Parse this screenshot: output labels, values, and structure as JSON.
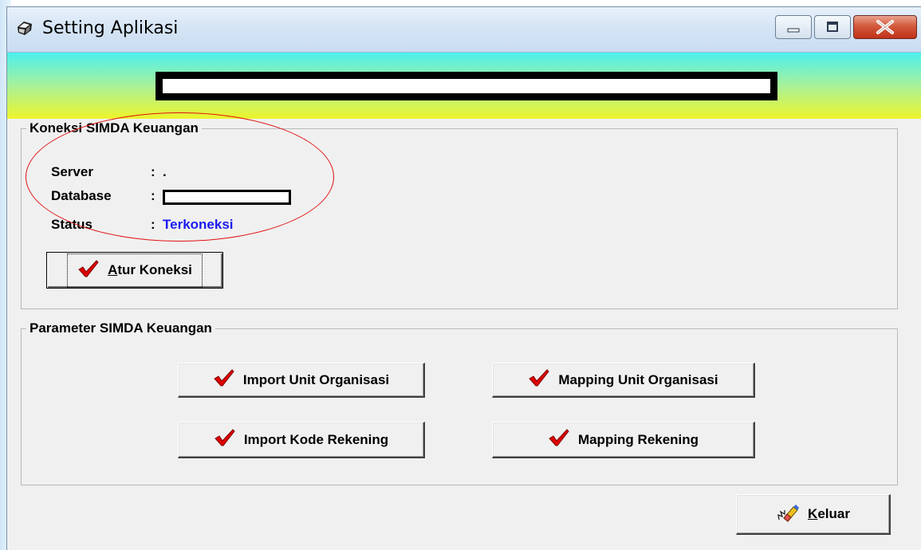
{
  "window": {
    "title": "Setting Aplikasi"
  },
  "titlebar_buttons": {
    "minimize": "minimize-icon",
    "maximize": "maximize-icon",
    "close": "close-icon"
  },
  "koneksi": {
    "legend": "Koneksi SIMDA Keuangan",
    "server_label": "Server",
    "server_value": ".",
    "database_label": "Database",
    "status_label": "Status",
    "status_value": "Terkoneksi",
    "colon": ":",
    "atur_accel": "A",
    "atur_rest": "tur Koneksi"
  },
  "parameter": {
    "legend": "Parameter SIMDA Keuangan",
    "import_unit": "Import Unit Organisasi",
    "mapping_unit": "Mapping Unit Organisasi",
    "import_kode": "Import Kode Rekening",
    "mapping_rekening": "Mapping Rekening"
  },
  "footer": {
    "keluar_accel": "K",
    "keluar_rest": "eluar"
  },
  "colors": {
    "status_blue": "#1a1af0",
    "check_red": "#e00000",
    "annotation_red": "#e01010"
  }
}
